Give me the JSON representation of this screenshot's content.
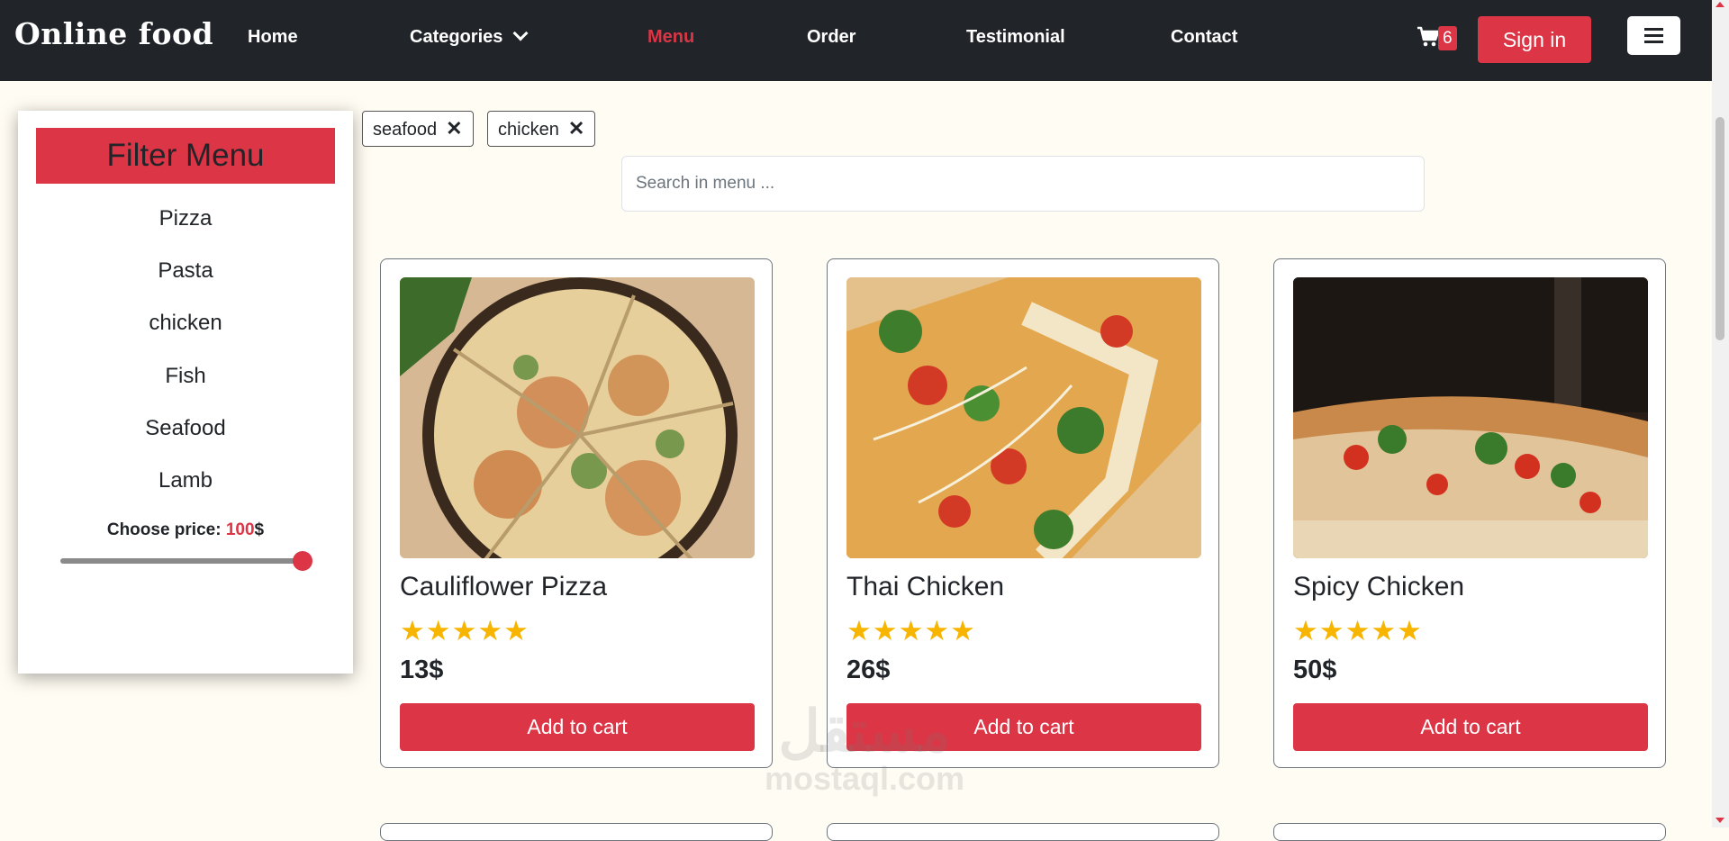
{
  "navbar": {
    "brand": "Online food",
    "links": [
      "Home",
      "Categories",
      "Menu",
      "Order",
      "Testimonial",
      "Contact"
    ],
    "active": "Menu",
    "cart_count": "6",
    "signin_label": "Sign in"
  },
  "filter": {
    "title": "Filter Menu",
    "items": [
      "Pizza",
      "Pasta",
      "chicken",
      "Fish",
      "Seafood",
      "Lamb"
    ],
    "price_label": "Choose price:",
    "price_value": "100",
    "price_unit": "$",
    "slider_fraction": 1.0
  },
  "tags": [
    "seafood",
    "chicken"
  ],
  "search": {
    "placeholder": "Search in menu ..."
  },
  "products": [
    {
      "name": "Cauliflower Pizza",
      "rating": 5,
      "price": "13$",
      "button": "Add to cart"
    },
    {
      "name": "Thai Chicken",
      "rating": 5,
      "price": "26$",
      "button": "Add to cart"
    },
    {
      "name": "Spicy Chicken",
      "rating": 5,
      "price": "50$",
      "button": "Add to cart"
    }
  ],
  "watermark": {
    "arabic": "مستقل",
    "latin": "mostaql.com"
  },
  "colors": {
    "accent": "#dc3545",
    "navbar": "#212529",
    "background": "#fffcf3",
    "star": "#f7b500"
  }
}
